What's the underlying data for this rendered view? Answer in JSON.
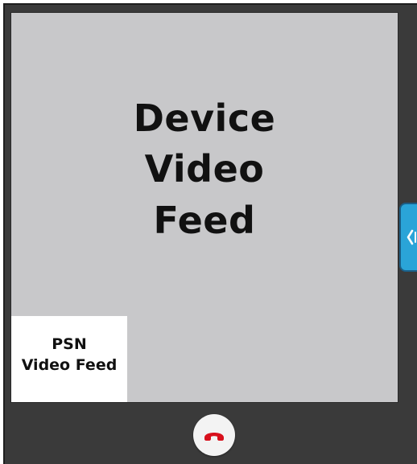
{
  "call": {
    "device_feed_label": "Device\nVideo\nFeed",
    "psn_feed_label": "PSN\nVideo Feed"
  },
  "controls": {
    "side_handle_icon": "chevron-left-bar-icon",
    "hangup_icon": "phone-hangup-icon"
  },
  "colors": {
    "panel_background": "#3a3a3a",
    "device_feed_background": "#c8c8ca",
    "psn_feed_background": "#ffffff",
    "side_handle": "#2aa4d8",
    "hangup_icon": "#d8101c"
  }
}
